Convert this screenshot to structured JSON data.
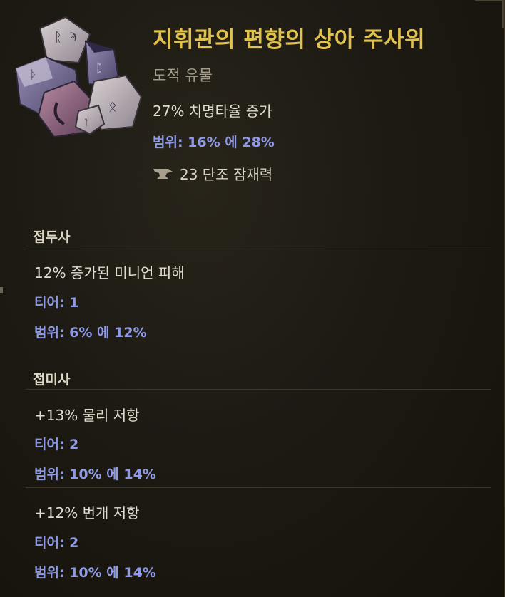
{
  "item": {
    "name": "지휘관의 편향의 상아 주사위",
    "type": "도적 유물",
    "affix": "27% 치명타율 증가",
    "range": "범위: 16% 에 28%",
    "forge_potential": "23 단조 잠재력",
    "icon": "ivory-dice-icon"
  },
  "sections": [
    {
      "header": "접두사",
      "affixes": [
        {
          "text": "12% 증가된 미니언 피해",
          "tier": "티어: 1",
          "range": "범위: 6% 에 12%"
        }
      ]
    },
    {
      "header": "접미사",
      "affixes": [
        {
          "text": "+13% 물리 저항",
          "tier": "티어: 2",
          "range": "범위: 10% 에 14%"
        },
        {
          "text": "+12% 번개 저항",
          "tier": "티어: 2",
          "range": "범위: 10% 에 14%"
        }
      ]
    }
  ],
  "colors": {
    "title": "#e2c24e",
    "subtitle": "#a49d8a",
    "text": "#e0dccf",
    "range": "#8e9ae8",
    "background": "#1c1a13"
  }
}
